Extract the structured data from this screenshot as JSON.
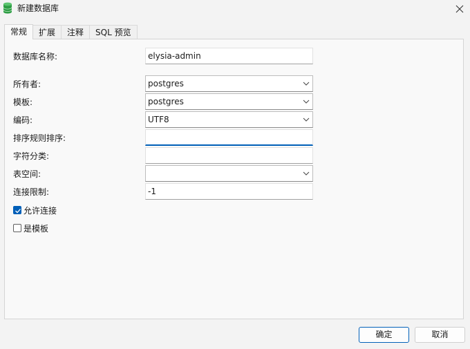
{
  "window": {
    "title": "新建数据库"
  },
  "tabs": [
    {
      "label": "常规",
      "active": true
    },
    {
      "label": "扩展",
      "active": false
    },
    {
      "label": "注释",
      "active": false
    },
    {
      "label": "SQL 预览",
      "active": false
    }
  ],
  "form": {
    "name": {
      "label": "数据库名称:",
      "value": "elysia-admin"
    },
    "owner": {
      "label": "所有者:",
      "value": "postgres"
    },
    "template": {
      "label": "模板:",
      "value": "postgres"
    },
    "encoding": {
      "label": "编码:",
      "value": "UTF8"
    },
    "collation": {
      "label": "排序规则排序:",
      "value": ""
    },
    "ctype": {
      "label": "字符分类:",
      "value": ""
    },
    "tablespace": {
      "label": "表空间:",
      "value": ""
    },
    "conn_limit": {
      "label": "连接限制:",
      "value": "-1"
    },
    "allow_conn": {
      "label": "允许连接",
      "checked": true
    },
    "is_template": {
      "label": "是模板",
      "checked": false
    }
  },
  "buttons": {
    "ok": "确定",
    "cancel": "取消"
  },
  "colors": {
    "accent": "#005fb8",
    "icon": "#2e9d44"
  }
}
